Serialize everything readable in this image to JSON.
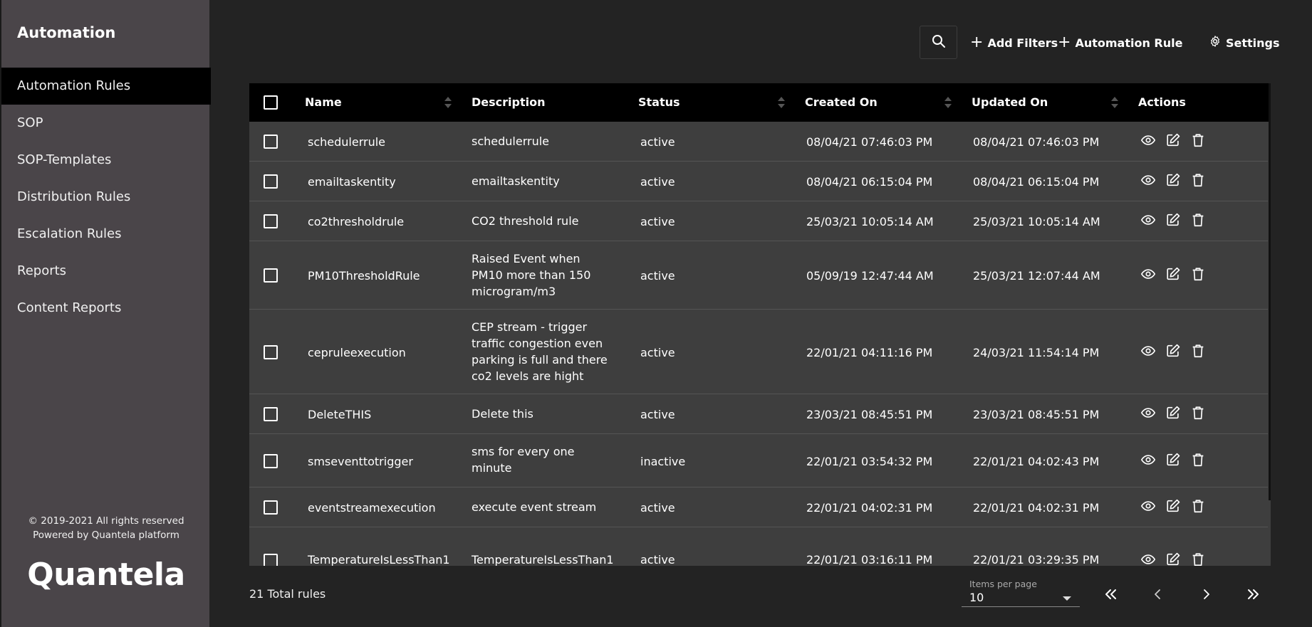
{
  "sidebar": {
    "title": "Automation",
    "items": [
      {
        "label": "Automation Rules",
        "active": true
      },
      {
        "label": "SOP"
      },
      {
        "label": "SOP-Templates"
      },
      {
        "label": "Distribution Rules"
      },
      {
        "label": "Escalation Rules"
      },
      {
        "label": "Reports"
      },
      {
        "label": "Content Reports"
      }
    ],
    "copyright_line1": "© 2019-2021 All rights reserved",
    "copyright_line2": "Powered by Quantela platform",
    "logo_text": "Quantela"
  },
  "toolbar": {
    "search_icon": "search-icon",
    "add_filters_label": "Add Filters",
    "automation_rule_label": "Automation Rule",
    "settings_label": "Settings"
  },
  "table": {
    "columns": [
      "Name",
      "Description",
      "Status",
      "Created On",
      "Updated On",
      "Actions"
    ],
    "rows": [
      {
        "name": "schedulerrule",
        "description": "schedulerrule",
        "status": "active",
        "created": "08/04/21 07:46:03 PM",
        "updated": "08/04/21 07:46:03 PM"
      },
      {
        "name": "emailtaskentity",
        "description": "emailtaskentity",
        "status": "active",
        "created": "08/04/21 06:15:04 PM",
        "updated": "08/04/21 06:15:04 PM"
      },
      {
        "name": "co2thresholdrule",
        "description": "CO2 threshold rule",
        "status": "active",
        "created": "25/03/21 10:05:14 AM",
        "updated": "25/03/21 10:05:14 AM"
      },
      {
        "name": "PM10ThresholdRule",
        "description": "Raised Event when PM10 more than 150 microgram/m3",
        "status": "active",
        "created": "05/09/19 12:47:44 AM",
        "updated": "25/03/21 12:07:44 AM"
      },
      {
        "name": "cepruleexecution",
        "description": "CEP stream - trigger traffic congestion even parking is full and there co2 levels are hight",
        "status": "active",
        "created": "22/01/21 04:11:16 PM",
        "updated": "24/03/21 11:54:14 PM"
      },
      {
        "name": "DeleteTHIS",
        "description": "Delete this",
        "status": "active",
        "created": "23/03/21 08:45:51 PM",
        "updated": "23/03/21 08:45:51 PM"
      },
      {
        "name": "smseventtotrigger",
        "description": "sms for every one minute",
        "status": "inactive",
        "created": "22/01/21 03:54:32 PM",
        "updated": "22/01/21 04:02:43 PM"
      },
      {
        "name": "eventstreamexecution",
        "description": "execute event stream",
        "status": "active",
        "created": "22/01/21 04:02:31 PM",
        "updated": "22/01/21 04:02:31 PM"
      },
      {
        "name": "TemperatureIsLessThan1",
        "description": "TemperatureIsLessThan1",
        "status": "active",
        "created": "22/01/21 03:16:11 PM",
        "updated": "22/01/21 03:29:35 PM"
      }
    ],
    "row_actions": [
      "eye-icon",
      "edit-icon",
      "trash-icon"
    ]
  },
  "footer": {
    "total_text": "21 Total rules",
    "items_per_page_label": "Items per page",
    "items_per_page_value": "10",
    "pager_icons": [
      "first-page-icon",
      "previous-page-icon",
      "next-page-icon",
      "last-page-icon"
    ]
  }
}
